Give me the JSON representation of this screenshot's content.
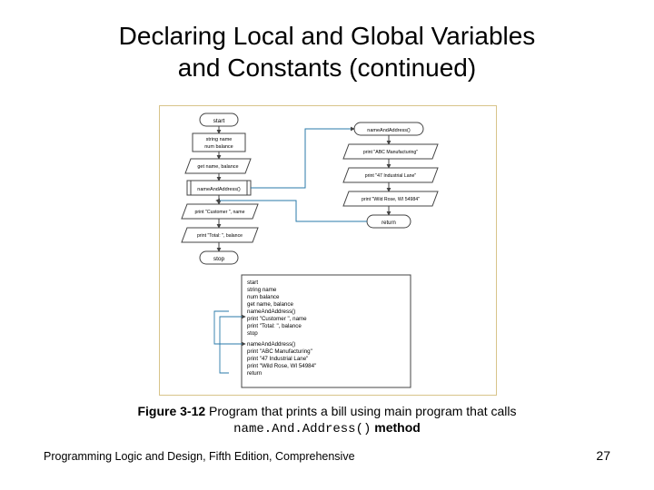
{
  "title_line1": "Declaring Local and Global Variables",
  "title_line2": "and Constants (continued)",
  "diagram": {
    "left": {
      "start": "start",
      "decl1": "string name",
      "decl2": "num balance",
      "io1": "get name, balance",
      "call1": "nameAndAddress()",
      "out1": "print \"Customer \", name",
      "out2": "print \"Total: \", balance",
      "stop": "stop"
    },
    "right": {
      "head": "nameAndAddress()",
      "p1": "print \"ABC Manufacturing\"",
      "p2": "print \"47 Industrial Lane\"",
      "p3": "print \"Wild Rose, WI 54984\"",
      "ret": "return"
    },
    "pseudocode": {
      "l1": "start",
      "l2": "    string name",
      "l3": "    num balance",
      "l4": "    get name, balance",
      "l5": "    nameAndAddress()",
      "l6": "    print \"Customer \", name",
      "l7": "    print \"Total: \", balance",
      "l8": "stop",
      "l9": "nameAndAddress()",
      "l10": "    print \"ABC Manufacturing\"",
      "l11": "    print \"47 Industrial Lane\"",
      "l12": "    print \"Wild Rose, WI 54984\"",
      "l13": "return"
    }
  },
  "caption_prefix": "Figure 3-12",
  "caption_body1": "  Program that prints a bill using main program that calls",
  "caption_code": "name.And.Address()",
  "caption_body2": " method",
  "footer_left": "Programming Logic and Design, Fifth Edition, Comprehensive",
  "page_number": "27"
}
